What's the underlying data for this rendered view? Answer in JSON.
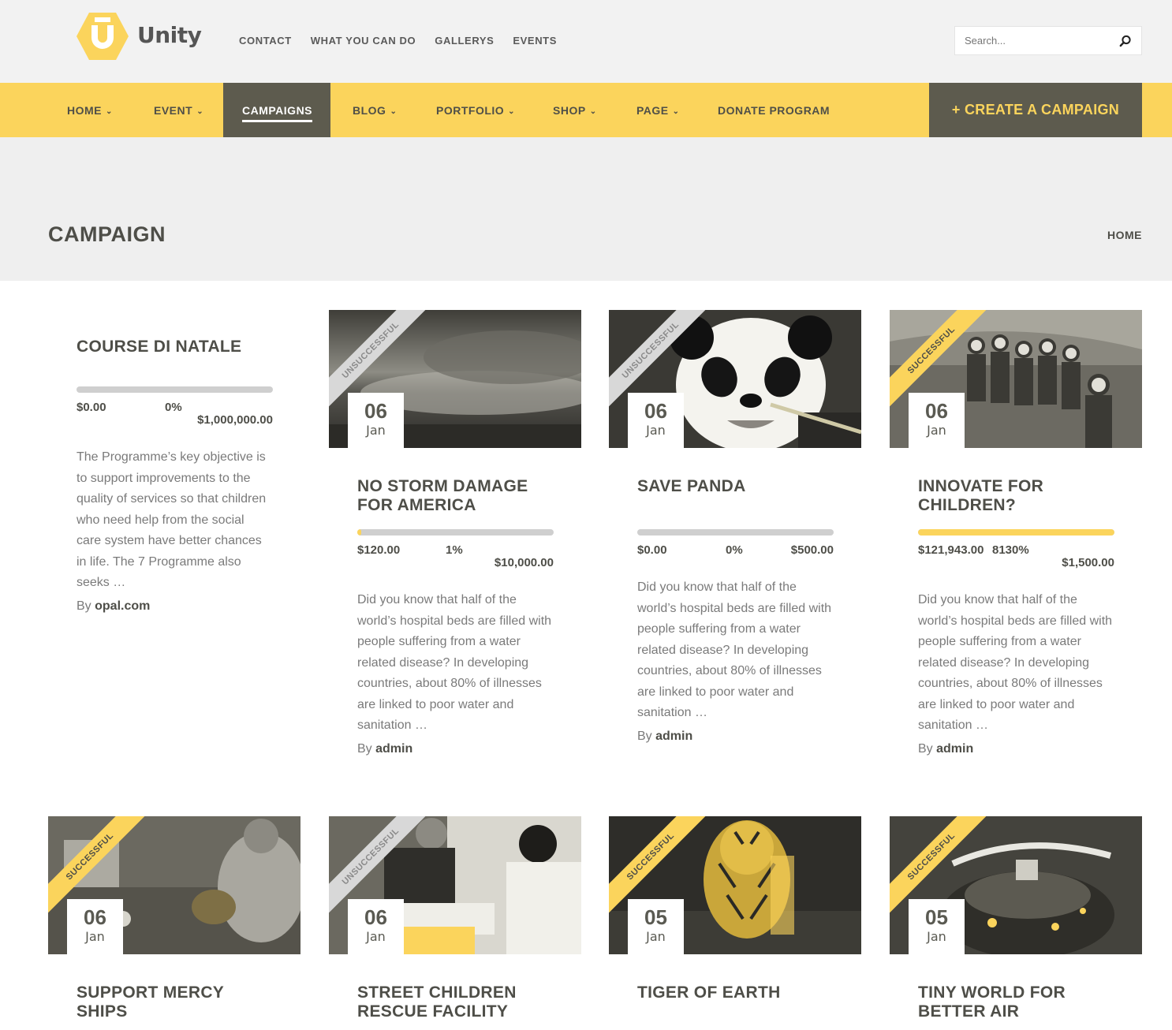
{
  "brand": {
    "name": "Unity",
    "accent": "#fbd45c",
    "dark": "#5d5b4e"
  },
  "topnav": [
    "CONTACT",
    "WHAT YOU CAN DO",
    "GALLERYS",
    "EVENTS"
  ],
  "search": {
    "placeholder": "Search..."
  },
  "mainnav": [
    {
      "label": "HOME",
      "dropdown": true
    },
    {
      "label": "EVENT",
      "dropdown": true
    },
    {
      "label": "CAMPAIGNS",
      "dropdown": false,
      "active": true
    },
    {
      "label": "BLOG",
      "dropdown": true
    },
    {
      "label": "PORTFOLIO",
      "dropdown": true
    },
    {
      "label": "SHOP",
      "dropdown": true
    },
    {
      "label": "PAGE",
      "dropdown": true
    },
    {
      "label": "DONATE PROGRAM",
      "dropdown": false
    }
  ],
  "create_button": "+ CREATE A CAMPAIGN",
  "page": {
    "title": "CAMPAIGN",
    "breadcrumb": "HOME"
  },
  "featured": {
    "title": "COURSE DI NATALE",
    "raised": "$0.00",
    "percent": "0%",
    "goal": "$1,000,000.00",
    "progress": 0,
    "description": "The Programme’s key objective is to support improvements to the quality of services so that children who need help from the social care system have better chances in life. The 7 Programme also seeks …",
    "by": "By",
    "author": "opal.com"
  },
  "campaigns": [
    {
      "status": "UNSUCCESSFUL",
      "day": "06",
      "month": "Jan",
      "image": "storm",
      "title": "NO STORM DAMAGE FOR AMERICA",
      "raised": "$120.00",
      "percent": "1%",
      "goal": "$10,000.00",
      "progress": 0.012,
      "description": "Did you know that half of the world’s hospital beds are filled with people suffering from a water related disease? In developing countries, about 80% of illnesses are linked to poor water and sanitation …",
      "by": "By",
      "author": "admin"
    },
    {
      "status": "UNSUCCESSFUL",
      "day": "06",
      "month": "Jan",
      "image": "panda",
      "title": "SAVE PANDA",
      "raised": "$0.00",
      "percent": "0%",
      "goal": "$500.00",
      "progress": 0,
      "description": "Did you know that half of the world’s hospital beds are filled with people suffering from a water related disease? In developing countries, about 80% of illnesses are linked to poor water and sanitation …",
      "by": "By",
      "author": "admin"
    },
    {
      "status": "SUCCESSFUL",
      "day": "06",
      "month": "Jan",
      "image": "children",
      "title": "INNOVATE FOR CHILDREN?",
      "raised": "$121,943.00",
      "percent": "8130%",
      "goal": "$1,500.00",
      "progress": 1,
      "description": "Did you know that half of the world’s hospital beds are filled with people suffering from a water related disease? In developing countries, about 80% of illnesses are linked to poor water and sanitation …",
      "by": "By",
      "author": "admin"
    },
    {
      "status": "SUCCESSFUL",
      "day": "06",
      "month": "Jan",
      "image": "mercy",
      "title": "SUPPORT MERCY SHIPS"
    },
    {
      "status": "UNSUCCESSFUL",
      "day": "06",
      "month": "Jan",
      "image": "street",
      "title": "STREET CHILDREN RESCUE FACILITY"
    },
    {
      "status": "SUCCESSFUL",
      "day": "05",
      "month": "Jan",
      "image": "tiger",
      "title": "TIGER OF EARTH"
    },
    {
      "status": "SUCCESSFUL",
      "day": "05",
      "month": "Jan",
      "image": "tinyworld",
      "title": "TINY WORLD FOR BETTER AIR"
    }
  ]
}
